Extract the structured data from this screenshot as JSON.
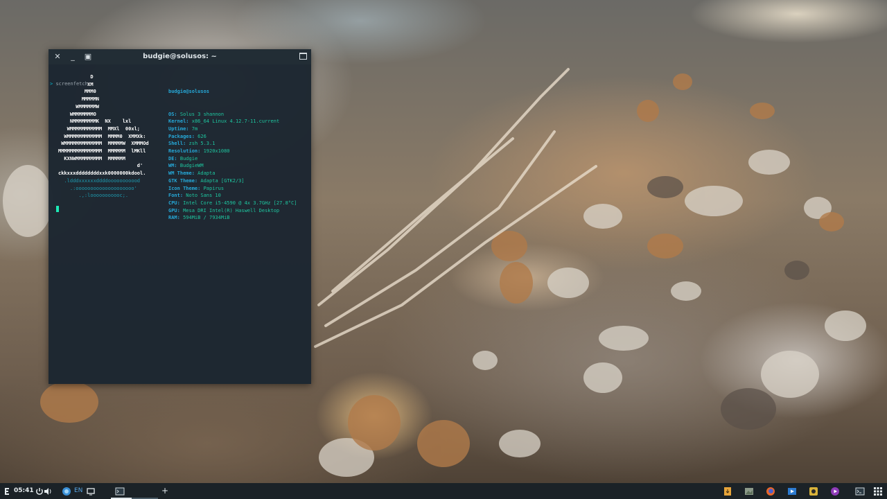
{
  "window": {
    "title": "budgie@solusos: ~"
  },
  "terminal": {
    "prompt_symbol": ">",
    "command": "screenfetch",
    "user_host": "budgie@solusos",
    "art_lines": [
      "           D",
      "          XM",
      "         MMM0",
      "        MMMMMN",
      "      WMMMMMMW",
      "    WMMMMMMMO",
      "    NMMMMMMMMK  NX    lxl",
      "   WMMMMMMMMMMM  MMXl  00xl;",
      "  WMMMMMMMMMMMM  MMMM0  XMMXk:",
      " WMMMMMMMMMMMMM  MMMMMW  XMMMOd",
      "MMMMMMMMMMMMMMM  MMMMMM  lMKll",
      "  KXNWMMMMMMMMM  MMMMMM",
      "                           d'",
      "ckkxxxddddddddxxk0000000kdool.",
      "  .ldddxxxxxxddddooooooooood",
      "    .:oooooooooooooooooooo'",
      "       .,:looooooooooc;."
    ],
    "info": [
      {
        "key": "OS:",
        "value": "Solus 3 shannon"
      },
      {
        "key": "Kernel:",
        "value": "x86_64 Linux 4.12.7-11.current"
      },
      {
        "key": "Uptime:",
        "value": "7m"
      },
      {
        "key": "Packages:",
        "value": "626"
      },
      {
        "key": "Shell:",
        "value": "zsh 5.3.1"
      },
      {
        "key": "Resolution:",
        "value": "1920x1080"
      },
      {
        "key": "DE:",
        "value": "Budgie"
      },
      {
        "key": "WM:",
        "value": "BudgieWM"
      },
      {
        "key": "WM Theme:",
        "value": "Adapta"
      },
      {
        "key": "GTK Theme:",
        "value": "Adapta [GTK2/3]"
      },
      {
        "key": "Icon Theme:",
        "value": "Papirus"
      },
      {
        "key": "Font:",
        "value": "Noto Sans 10"
      },
      {
        "key": "CPU:",
        "value": "Intel Core i5-4590 @ 4x 3.7GHz [27.8°C]"
      },
      {
        "key": "GPU:",
        "value": "Mesa DRI Intel(R) Haswell Desktop"
      },
      {
        "key": "RAM:",
        "value": "594MiB / 7934MiB"
      }
    ]
  },
  "panel": {
    "clock": "05:41",
    "language": "EN",
    "new_tab_label": "+",
    "tray_icons": [
      "download-icon",
      "image-viewer-icon",
      "firefox-icon",
      "video-icon",
      "rhythmbox-icon",
      "media-player-icon",
      "terminal-icon",
      "app-grid-icon"
    ]
  },
  "colors": {
    "terminal_bg": "#1d2731",
    "titlebar_bg": "#222d35",
    "panel_bg": "#1b2227",
    "accent_cyan": "#26a9d9",
    "accent_green": "#1ec7a0"
  }
}
